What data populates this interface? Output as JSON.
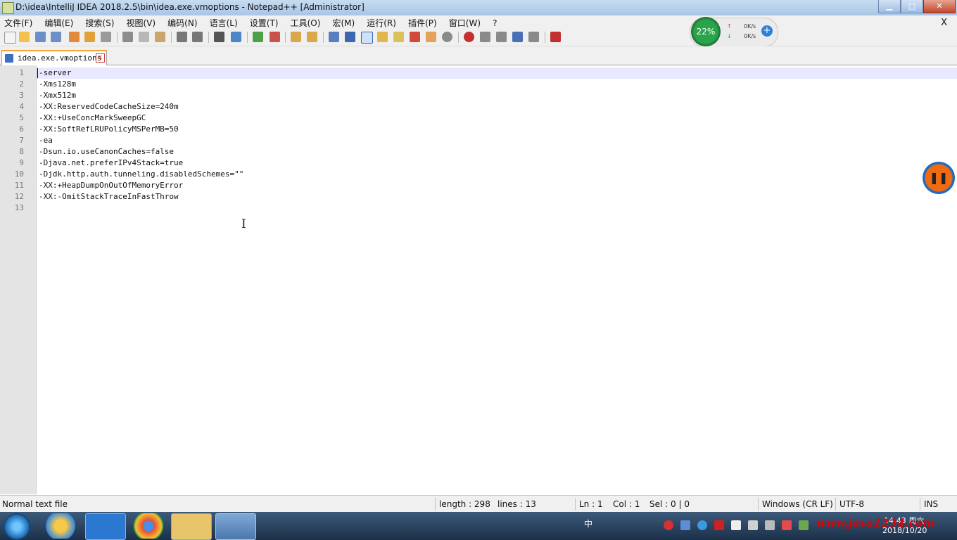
{
  "window": {
    "title": "D:\\idea\\IntelliJ IDEA 2018.2.5\\bin\\idea.exe.vmoptions - Notepad++ [Administrator]",
    "minimize": "▁",
    "maximize": "□",
    "close": "✕"
  },
  "menu": {
    "items": [
      "文件(F)",
      "编辑(E)",
      "搜索(S)",
      "视图(V)",
      "编码(N)",
      "语言(L)",
      "设置(T)",
      "工具(O)",
      "宏(M)",
      "运行(R)",
      "插件(P)",
      "窗口(W)",
      "?"
    ],
    "close_glyph": "X"
  },
  "net_monitor": {
    "percent": "22%",
    "up_speed": "0K/s",
    "down_speed": "0K/s",
    "up_arrow": "↑",
    "down_arrow": "↓",
    "plus": "+"
  },
  "tab": {
    "label": "idea.exe.vmoptions",
    "close": "x"
  },
  "editor": {
    "lines": [
      "-server",
      "-Xms128m",
      "-Xmx512m",
      "-XX:ReservedCodeCacheSize=240m",
      "-XX:+UseConcMarkSweepGC",
      "-XX:SoftRefLRUPolicyMSPerMB=50",
      "-ea",
      "-Dsun.io.useCanonCaches=false",
      "-Djava.net.preferIPv4Stack=true",
      "-Djdk.http.auth.tunneling.disabledSchemes=\"\"",
      "-XX:+HeapDumpOnOutOfMemoryError",
      "-XX:-OmitStackTraceInFastThrow",
      ""
    ],
    "line_numbers": [
      "1",
      "2",
      "3",
      "4",
      "5",
      "6",
      "7",
      "8",
      "9",
      "10",
      "11",
      "12",
      "13"
    ]
  },
  "status": {
    "file_type": "Normal text file",
    "length": "length : 298",
    "lines": "lines : 13",
    "ln": "Ln : 1",
    "col": "Col : 1",
    "sel": "Sel : 0 | 0",
    "eol": "Windows (CR LF)",
    "encoding": "UTF-8",
    "mode": "INS"
  },
  "taskbar": {
    "ime": "中",
    "time": "14:43 周六",
    "date": "2018/10/20"
  },
  "watermark": "www.java1234.com",
  "colors": {
    "tab_accent": "#f6a33d",
    "current_line": "#e8e8ff",
    "gutter": "#e4e4e4",
    "net_green": "#2aa44a",
    "pause_orange": "#f06a12"
  },
  "icons": {
    "toolbar": [
      "new-icon",
      "open-icon",
      "save-icon",
      "save-all-icon",
      "close-icon",
      "close-all-icon",
      "print-icon",
      "cut-icon",
      "copy-icon",
      "paste-icon",
      "undo-icon",
      "redo-icon",
      "find-icon",
      "replace-icon",
      "zoom-in-icon",
      "zoom-out-icon",
      "sync-v-icon",
      "sync-h-icon",
      "wrap-icon",
      "show-all-icon",
      "indent-guide-icon",
      "udl-icon",
      "doc-map-icon",
      "function-list-icon",
      "folder-workspace-icon",
      "monitor-icon",
      "record-macro-icon",
      "stop-macro-icon",
      "play-macro-icon",
      "run-macro-multiple-icon",
      "save-macro-icon",
      "spellcheck-icon"
    ]
  }
}
